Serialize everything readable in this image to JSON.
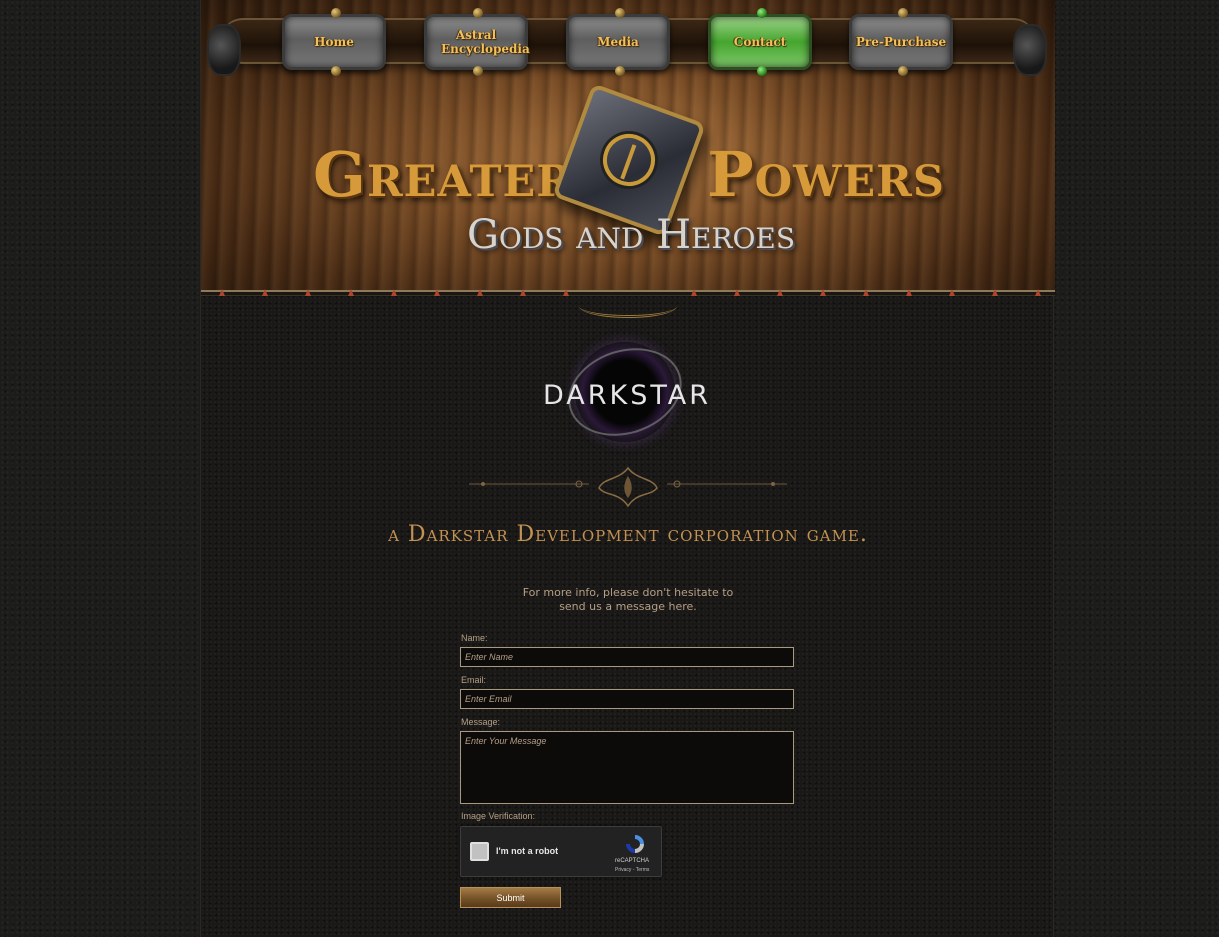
{
  "nav": {
    "items": [
      {
        "label": "Home",
        "active": false
      },
      {
        "label": "Astral Encyclopedia",
        "active": false
      },
      {
        "label": "Media",
        "active": false
      },
      {
        "label": "Contact",
        "active": true
      },
      {
        "label": "Pre-Purchase",
        "active": false
      }
    ]
  },
  "banner": {
    "title_left": "Greater",
    "title_right": "Powers",
    "subtitle": "Gods and Heroes"
  },
  "logo": {
    "text": "DARKSTAR"
  },
  "tagline": "a Darkstar Development corporation game.",
  "info": {
    "line1": "For more info, please don't hesitate to",
    "line2": "send us a message here."
  },
  "form": {
    "name_label": "Name:",
    "name_placeholder": "Enter Name",
    "email_label": "Email:",
    "email_placeholder": "Enter Email",
    "message_label": "Message:",
    "message_placeholder": "Enter Your Message",
    "verification_label": "Image Verification:",
    "submit_label": "Submit"
  },
  "captcha": {
    "label": "I'm not a robot",
    "brand": "reCAPTCHA",
    "links": "Privacy - Terms"
  },
  "colors": {
    "accent_gold": "#c39151",
    "nav_text": "#f3c15a",
    "active_nav": "#45a52e",
    "form_text": "#b59f86"
  }
}
